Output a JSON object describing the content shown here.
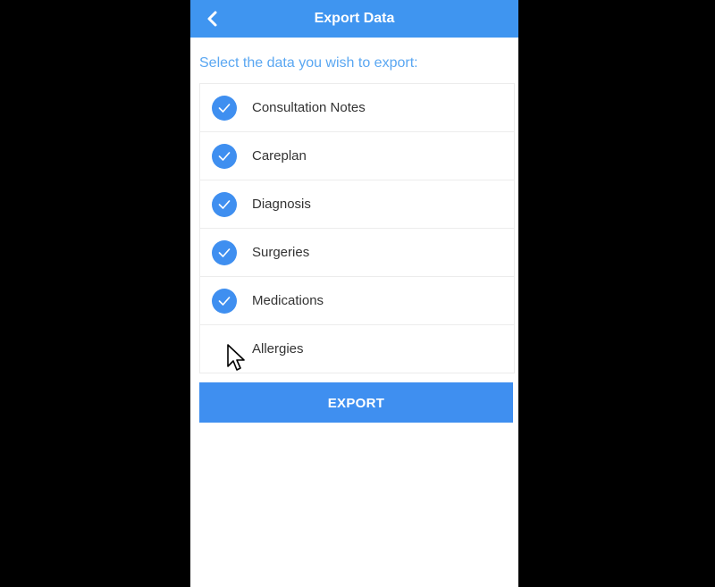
{
  "header": {
    "title": "Export Data",
    "back_icon": "chevron-left-icon"
  },
  "instruction": "Select the data you wish to export:",
  "items": [
    {
      "label": "Consultation Notes",
      "checked": true
    },
    {
      "label": "Careplan",
      "checked": true
    },
    {
      "label": "Diagnosis",
      "checked": true
    },
    {
      "label": "Surgeries",
      "checked": true
    },
    {
      "label": "Medications",
      "checked": true
    },
    {
      "label": "Allergies",
      "checked": false
    }
  ],
  "export_button": {
    "label": "EXPORT"
  },
  "colors": {
    "accent": "#3f8ff0",
    "header": "#3f95f0",
    "instruction_text": "#5aa7f2",
    "background": "#000000"
  }
}
